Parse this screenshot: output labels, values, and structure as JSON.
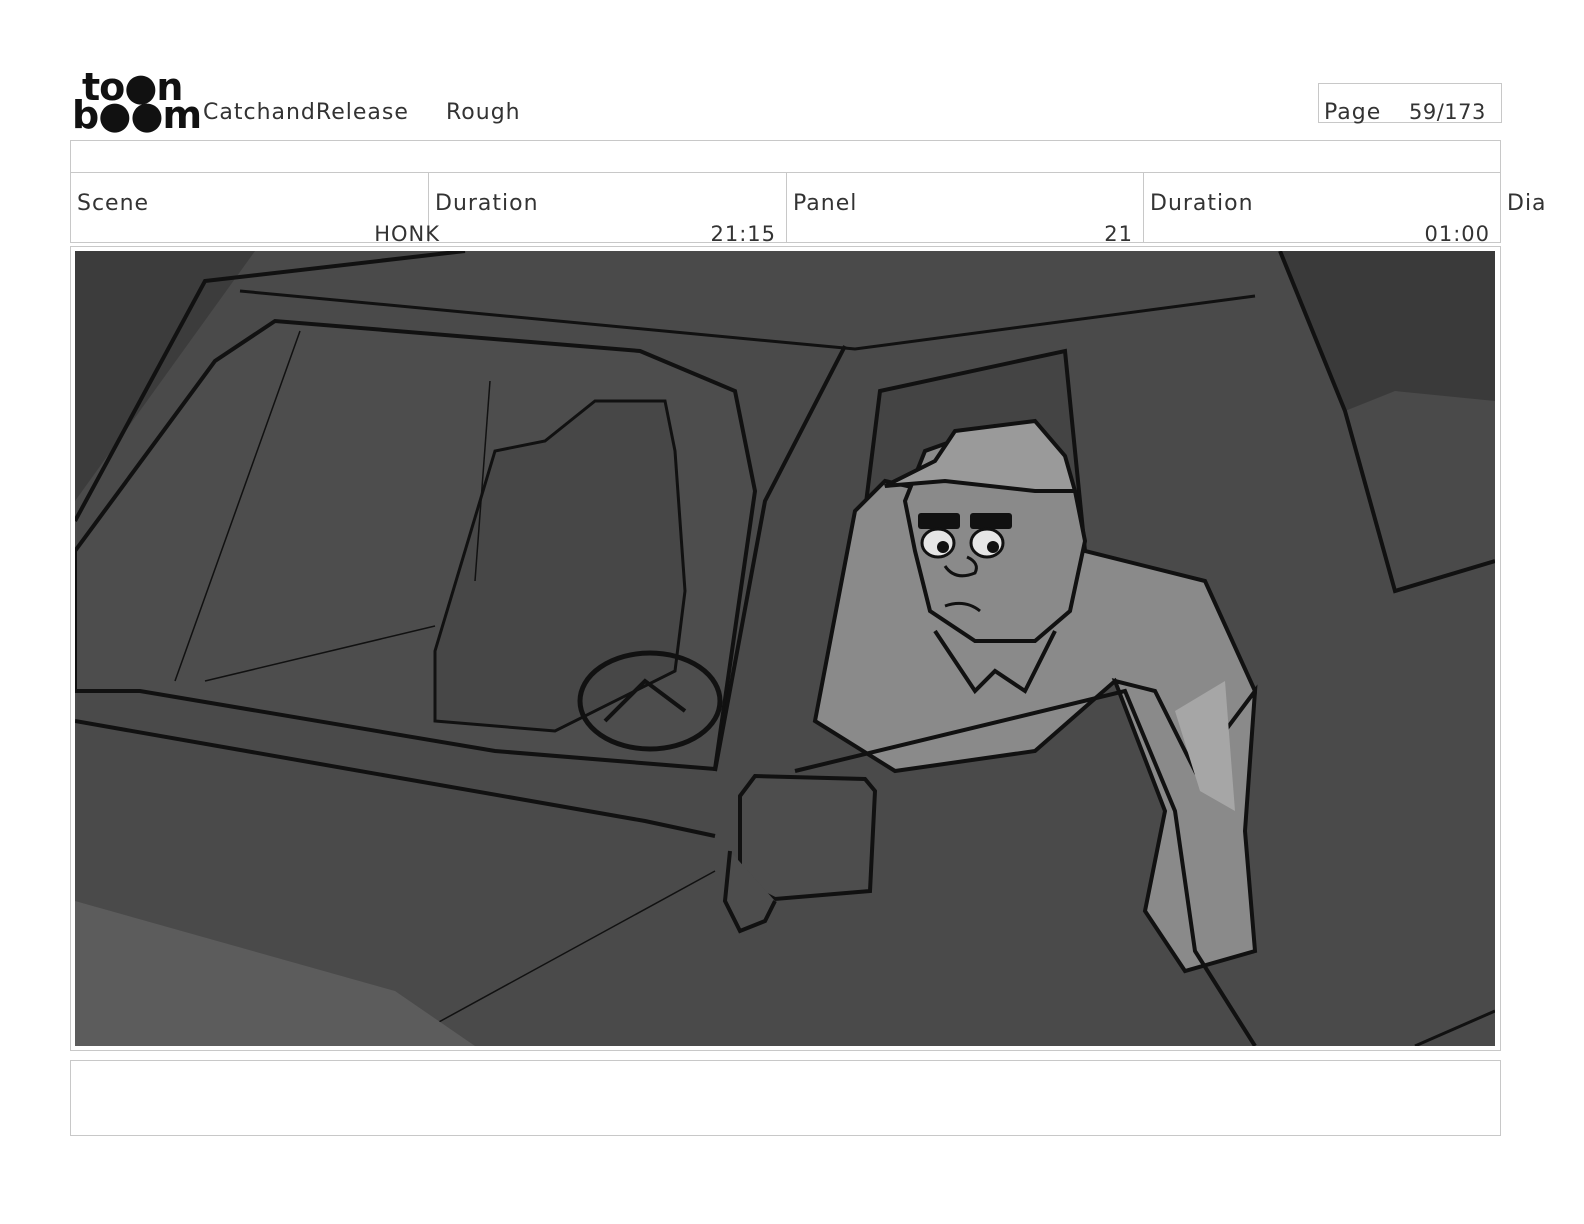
{
  "header": {
    "logo": {
      "line1": "to●n",
      "line2": "b●●m"
    },
    "project": "CatchandRelease",
    "stage": "Rough",
    "page_label": "Page",
    "page_value": "59/173"
  },
  "info": {
    "scene_label": "Scene",
    "scene_value": "HONK",
    "scene_duration_label": "Duration",
    "scene_duration_value": "21:15",
    "panel_label": "Panel",
    "panel_value": "21",
    "panel_duration_label": "Duration",
    "panel_duration_value": "01:00",
    "dialogue_label": "Dia"
  },
  "colors": {
    "frame_background": "#4a4a4a",
    "border": "#c8c8c8",
    "figure_light": "#8a8a8a",
    "figure_highlight": "#a6a6a6"
  },
  "icons": {
    "logo": "toonboom-logo",
    "frame": "storyboard-drawing"
  }
}
